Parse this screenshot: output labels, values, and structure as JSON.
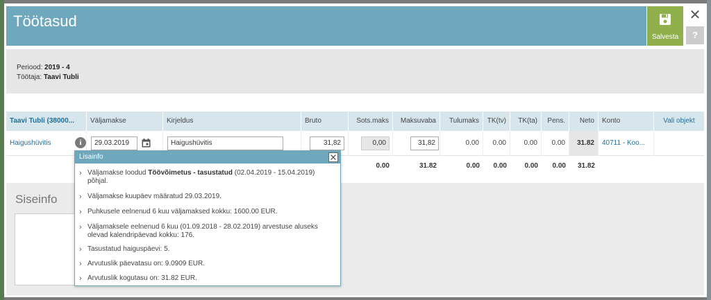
{
  "page": {
    "title": "Töötasud"
  },
  "toolbar": {
    "save_label": "Salvesta",
    "close_label": "✕",
    "help_label": "?"
  },
  "info": {
    "period_label": "Periood: ",
    "period_value": "2019 - 4",
    "employee_label": "Töötaja: ",
    "employee_value": "Taavi Tubli"
  },
  "grid": {
    "headers": [
      "Taavi Tubli (38000...",
      "Väljamakse",
      "Kirjeldus",
      "Bruto",
      "Sots.maks",
      "Maksuvaba",
      "Tulumaks",
      "TK(tv)",
      "TK(ta)",
      "Pens.",
      "Neto",
      "Konto",
      "Vali objekt"
    ],
    "row": {
      "type": "Haigushüvitis",
      "info_icon": "i",
      "date": "29.03.2019",
      "description": "Haigushüvitis",
      "bruto": "31,82",
      "sots": "0,00",
      "maksuvaba": "31,82",
      "tulumaks": "0.00",
      "tk_tv": "0.00",
      "tk_ta": "0.00",
      "pens": "0.00",
      "neto": "31.82",
      "konto": "40711 - Koo..."
    },
    "totals": {
      "sots": "0.00",
      "maksuvaba": "31.82",
      "tulumaks": "0.00",
      "tk_tv": "0.00",
      "tk_ta": "0.00",
      "pens": "0.00",
      "neto": "31.82"
    }
  },
  "siseinfo": {
    "title": "Siseinfo"
  },
  "popup": {
    "title": "Lisainfo",
    "item1_pre": "Väljamakse loodud ",
    "item1_bold": "Töövõimetus - tasustatud",
    "item1_post": " (02.04.2019 - 15.04.2019) põhjal.",
    "items": [
      "Väljamakse kuupäev määratud 29.03.2019.",
      "Puhkusele eelnenud 6 kuu väljamaksed kokku: 1600.00 EUR.",
      "Väljamaksele eelnenud 6 kuu (01.09.2018 - 28.02.2019) arvestuse aluseks olevad kalendripäevad kokku: 176.",
      "Tasustatud haiguspäevi: 5.",
      "Arvutuslik päevatasu on: 9.0909 EUR.",
      "Arvutuslik kogutasu on: 31.82 EUR."
    ]
  },
  "colors": {
    "header": "#6fa8bd",
    "save": "#8fb04a",
    "link": "#1f6f99"
  }
}
